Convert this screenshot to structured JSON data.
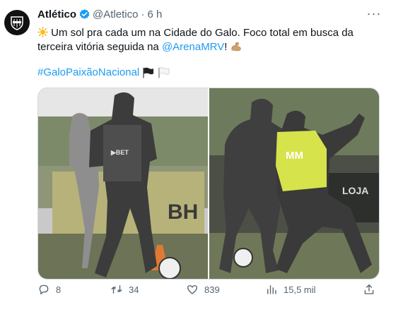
{
  "tweet": {
    "display_name": "Atlético",
    "handle": "@Atletico",
    "separator": "·",
    "time": "6 h",
    "more_label": "···",
    "text": {
      "part1": " Um sol pra cada um na Cidade do Galo. Foco total em busca da terceira vitória seguida na ",
      "mention": "@ArenaMRV",
      "part2": "! "
    },
    "hashtag": "#GaloPaixãoNacional"
  },
  "actions": {
    "replies": "8",
    "reposts": "34",
    "likes": "839",
    "views": "15,5 mil"
  },
  "media": {
    "left_banner_text": "BH",
    "right_banner_text": "LOJA"
  },
  "colors": {
    "link": "#1d9bf0",
    "muted": "#536471",
    "verified": "#1d9bf0",
    "bib": "#d6e34a"
  },
  "icons": [
    "avatar-logo",
    "verified-icon",
    "more-icon",
    "sun-emoji",
    "flexed-arm-emoji",
    "black-flag-emoji",
    "white-flag-emoji",
    "reply-icon",
    "repost-icon",
    "like-icon",
    "views-icon",
    "share-icon"
  ]
}
